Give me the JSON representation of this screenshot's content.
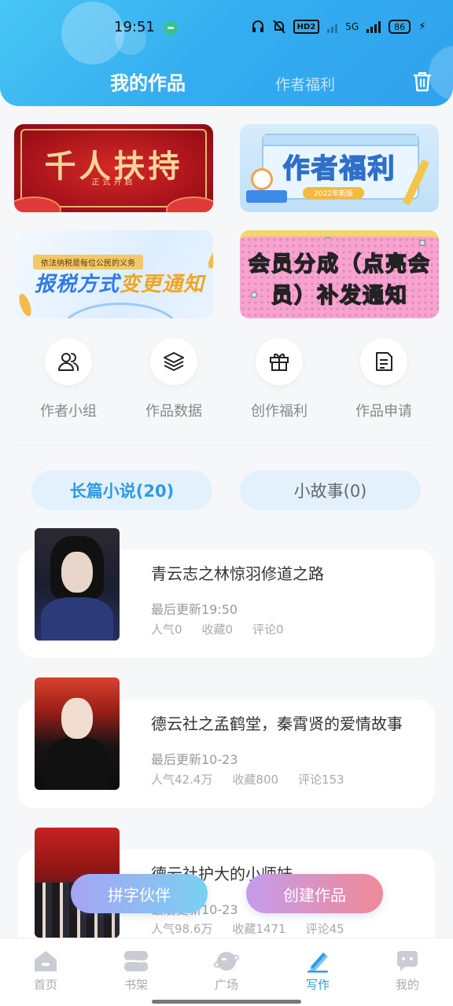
{
  "status_bar": {
    "time": "19:51",
    "hd_label": "HD2",
    "network": "5G",
    "battery": "86"
  },
  "header": {
    "tab_my_works": "我的作品",
    "tab_author_welfare": "作者福利",
    "trash_icon": "trash-icon"
  },
  "banners": [
    {
      "main": "千人扶持",
      "sub": "正式开启"
    },
    {
      "main": "作者福利",
      "tag": "2022年新版"
    },
    {
      "ribbon": "依法纳税是每位公民的义务",
      "main_a": "报税方式",
      "main_b": "变更通知"
    },
    {
      "main": "会员分成（点亮会员）补发通知"
    }
  ],
  "quick_actions": [
    {
      "label": "作者小组",
      "icon": "users-icon"
    },
    {
      "label": "作品数据",
      "icon": "layers-icon"
    },
    {
      "label": "创作福利",
      "icon": "gift-icon"
    },
    {
      "label": "作品申请",
      "icon": "document-icon"
    }
  ],
  "category_tabs": {
    "long_novel": "长篇小说(20)",
    "short_story": "小故事(0)"
  },
  "works": [
    {
      "title": "青云志之林惊羽修道之路",
      "updated": "最后更新19:50",
      "popularity": "人气0",
      "favorites": "收藏0",
      "comments": "评论0"
    },
    {
      "title": "德云社之孟鹤堂，秦霄贤的爱情故事",
      "updated": "最后更新10-23",
      "popularity": "人气42.4万",
      "favorites": "收藏800",
      "comments": "评论153"
    },
    {
      "title": "德云社护大的小师妹",
      "updated": "最后更新10-23",
      "popularity": "人气98.6万",
      "favorites": "收藏1471",
      "comments": "评论45"
    }
  ],
  "fab": {
    "partner": "拼字伙伴",
    "create": "创建作品"
  },
  "bottom_nav": [
    {
      "label": "首页",
      "icon": "home-icon"
    },
    {
      "label": "书架",
      "icon": "bookshelf-icon"
    },
    {
      "label": "广场",
      "icon": "planet-icon"
    },
    {
      "label": "写作",
      "icon": "pen-icon",
      "active": true
    },
    {
      "label": "我的",
      "icon": "profile-icon"
    }
  ],
  "colors": {
    "accent": "#2d9be6",
    "header_gradient_start": "#48c6f4",
    "header_gradient_end": "#2ea2ee"
  }
}
